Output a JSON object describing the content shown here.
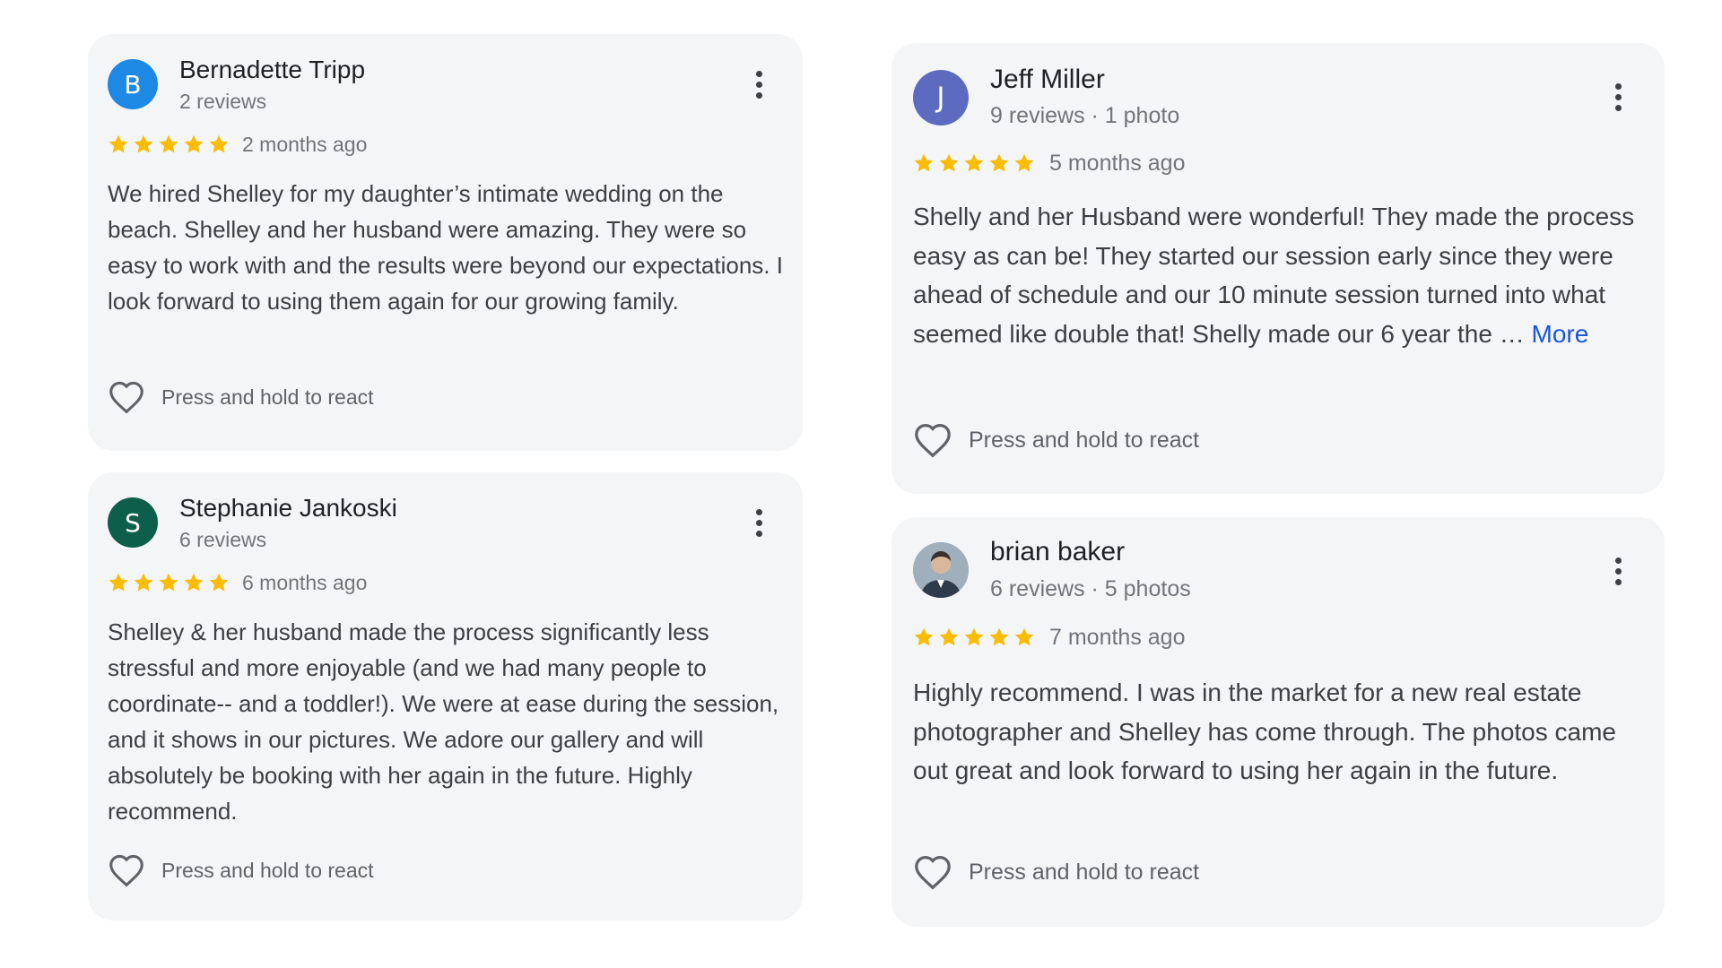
{
  "colors": {
    "card_bg": "#f4f5f7",
    "star": "#fbbc04",
    "link": "#1a56db",
    "avatar_b": "#1e88e5",
    "avatar_j": "#5c6bc0",
    "avatar_s": "#0d5e4a"
  },
  "reviews": [
    {
      "avatar_letter": "B",
      "name": "Bernadette Tripp",
      "meta": "2 reviews",
      "rating": 5,
      "time": "2 months ago",
      "text": "We hired Shelley for my daughter’s intimate wedding on the beach. Shelley and her husband were amazing. They were so easy to work with and the results were beyond our expectations. I look forward to using them again for our growing family.",
      "react_label": "Press and hold to react",
      "menu_icon": "more-vert-icon",
      "react_icon": "heart-outline-icon"
    },
    {
      "avatar_letter": "J",
      "name": "Jeff Miller",
      "meta": "9 reviews · 1 photo",
      "rating": 5,
      "time": "5 months ago",
      "text": "Shelly and her Husband were wonderful! They made the process easy as can be! They started our session early since they were ahead of schedule and our 10 minute session turned into what seemed like double that! Shelly made our 6 year the … ",
      "more_link": "More",
      "react_label": "Press and hold to react",
      "menu_icon": "more-vert-icon",
      "react_icon": "heart-outline-icon"
    },
    {
      "avatar_letter": "S",
      "name": "Stephanie Jankoski",
      "meta": "6 reviews",
      "rating": 5,
      "time": "6 months ago",
      "text": "Shelley & her husband made the process significantly less stressful and more enjoyable (and we had many people to coordinate-- and a toddler!). We were at ease during the session, and it shows in our pictures. We adore our gallery and will absolutely be booking with her again in the future. Highly recommend.",
      "react_label": "Press and hold to react",
      "menu_icon": "more-vert-icon",
      "react_icon": "heart-outline-icon"
    },
    {
      "avatar_icon": "profile-photo-icon",
      "name": "brian baker",
      "meta": "6 reviews · 5 photos",
      "rating": 5,
      "time": "7 months ago",
      "text": "Highly recommend. I was in the market for a new real estate photographer and Shelley has come through. The photos came out great and look forward to using her again in the future.",
      "react_label": "Press and hold to react",
      "menu_icon": "more-vert-icon",
      "react_icon": "heart-outline-icon"
    }
  ]
}
